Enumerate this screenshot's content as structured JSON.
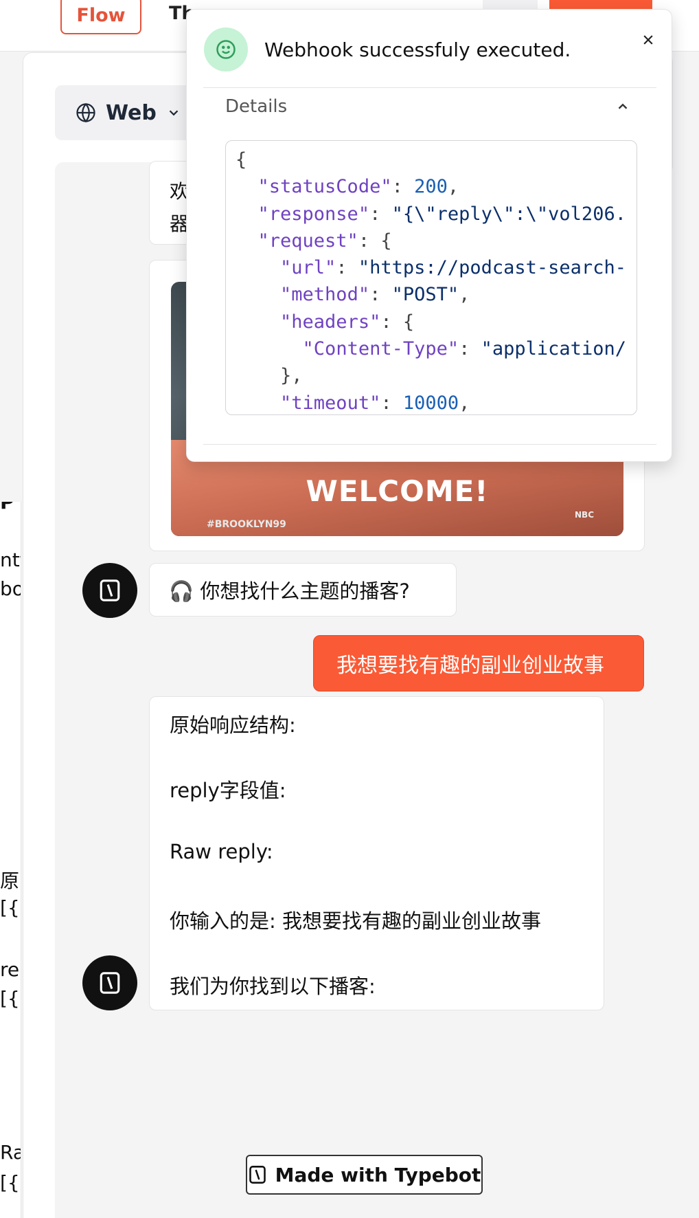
{
  "topbar": {
    "flow_tab": "Flow",
    "theme_tab": "Th"
  },
  "runtime": {
    "label": "Web"
  },
  "chat": {
    "welcome_fragment": "欢\n器",
    "gif_text": "WELCOME!",
    "gif_tag": "#BROOKLYN99",
    "gif_network": "NBC",
    "bot_question": "🎧 你想找什么主题的播客?",
    "user_reply": "我想要找有趣的副业创业故事",
    "bot_response_lines": [
      "原始响应结构:",
      "reply字段值:",
      "Raw reply:",
      "你输入的是: 我想要找有趣的副业创业故事",
      "我们为你找到以下播客:"
    ]
  },
  "left_fragments": [
    "P I",
    "ntt",
    "bot",
    "原:",
    "[{h",
    "re",
    "[{h",
    "Ra",
    "[{h"
  ],
  "footer": {
    "made_with": "Made with Typebot"
  },
  "toast": {
    "title": "Webhook successfuly executed.",
    "details_label": "Details",
    "code_lines": [
      [
        {
          "t": "p",
          "v": "{"
        }
      ],
      [
        {
          "t": "p",
          "v": "  "
        },
        {
          "t": "k",
          "v": "\"statusCode\""
        },
        {
          "t": "p",
          "v": ": "
        },
        {
          "t": "n",
          "v": "200"
        },
        {
          "t": "p",
          "v": ","
        }
      ],
      [
        {
          "t": "p",
          "v": "  "
        },
        {
          "t": "k",
          "v": "\"response\""
        },
        {
          "t": "p",
          "v": ": "
        },
        {
          "t": "s",
          "v": "\"{\\\"reply\\\":\\\"vol206."
        }
      ],
      [
        {
          "t": "p",
          "v": "  "
        },
        {
          "t": "k",
          "v": "\"request\""
        },
        {
          "t": "p",
          "v": ": {"
        }
      ],
      [
        {
          "t": "p",
          "v": "    "
        },
        {
          "t": "k",
          "v": "\"url\""
        },
        {
          "t": "p",
          "v": ": "
        },
        {
          "t": "s",
          "v": "\"https://podcast-search-"
        }
      ],
      [
        {
          "t": "p",
          "v": "    "
        },
        {
          "t": "k",
          "v": "\"method\""
        },
        {
          "t": "p",
          "v": ": "
        },
        {
          "t": "s",
          "v": "\"POST\""
        },
        {
          "t": "p",
          "v": ","
        }
      ],
      [
        {
          "t": "p",
          "v": "    "
        },
        {
          "t": "k",
          "v": "\"headers\""
        },
        {
          "t": "p",
          "v": ": {"
        }
      ],
      [
        {
          "t": "p",
          "v": "      "
        },
        {
          "t": "k",
          "v": "\"Content-Type\""
        },
        {
          "t": "p",
          "v": ": "
        },
        {
          "t": "s",
          "v": "\"application/"
        }
      ],
      [
        {
          "t": "p",
          "v": "    },"
        }
      ],
      [
        {
          "t": "p",
          "v": "    "
        },
        {
          "t": "k",
          "v": "\"timeout\""
        },
        {
          "t": "p",
          "v": ": "
        },
        {
          "t": "n",
          "v": "10000"
        },
        {
          "t": "p",
          "v": ","
        }
      ]
    ]
  },
  "colors": {
    "accent": "#fa5a35",
    "success_bg": "#c6f2d5",
    "json_key": "#6f42c1",
    "json_number": "#1a5fb4"
  }
}
